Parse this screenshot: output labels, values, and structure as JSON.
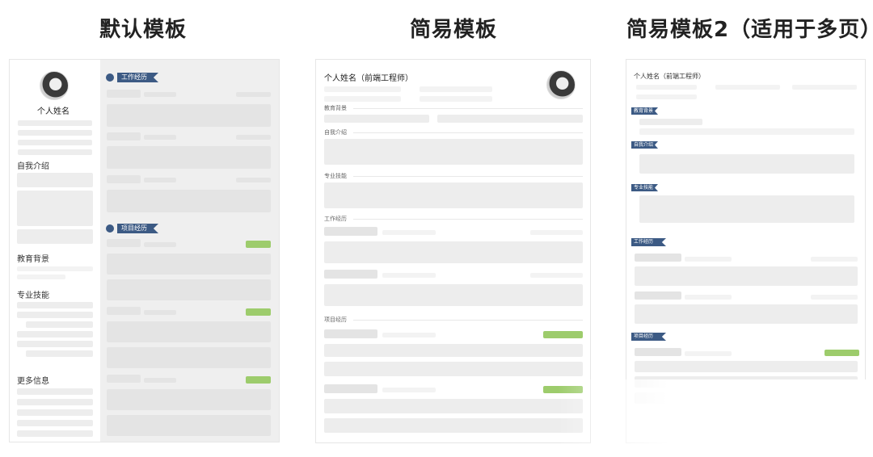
{
  "titles": {
    "default": "默认模板",
    "simple": "简易模板",
    "simple2": "简易模板2（适用于多页）"
  },
  "default_card": {
    "name": "个人姓名",
    "sections_left": {
      "intro": "自我介绍",
      "education": "教育背景",
      "skills": "专业技能",
      "more": "更多信息"
    },
    "sections_right": {
      "work": "工作经历",
      "project": "项目经历"
    }
  },
  "simple_card": {
    "name": "个人姓名（前端工程师）",
    "sections": {
      "education": "教育背景",
      "intro": "自我介绍",
      "skills": "专业技能",
      "work": "工作经历",
      "project": "项目经历"
    }
  },
  "simple2_card": {
    "name": "个人姓名（前端工程师）",
    "sections": {
      "education": "教育背景",
      "intro": "自我介绍",
      "skills": "专业技能",
      "work": "工作经历",
      "project": "项目经历"
    }
  },
  "colors": {
    "accent": "#3c5a84",
    "highlight": "#9dcc6c",
    "placeholder": "#ededed"
  }
}
